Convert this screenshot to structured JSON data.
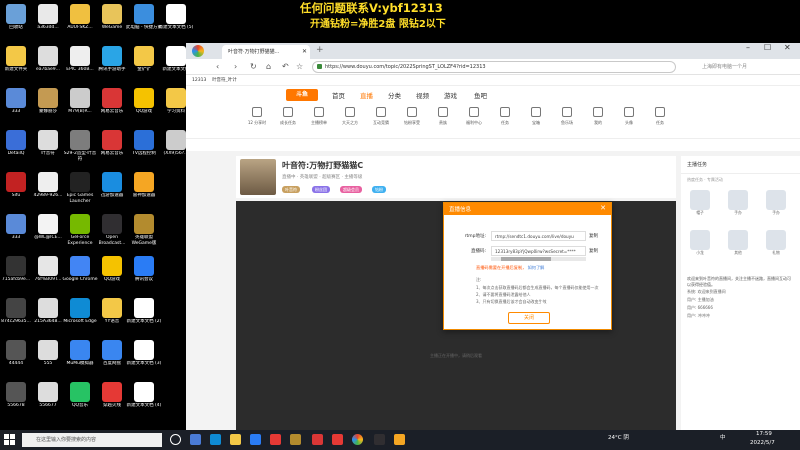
{
  "banner": {
    "line1": "任何问题联系V:ybf12313",
    "line2": "开通钻粉=净胜2盘 限钻2以下"
  },
  "desktop_icons": [
    {
      "label": "回收站",
      "color": "#6aa0d8"
    },
    {
      "label": "a363dd...",
      "color": "#e9e9e9"
    },
    {
      "label": "AUUFSKZ...",
      "color": "#f0c040"
    },
    {
      "label": "WeGame",
      "color": "#e8c45a"
    },
    {
      "label": "此电脑 - 快捷方式",
      "color": "#3b8ede"
    },
    {
      "label": "新建文本文档 (5)",
      "color": "#ffffff"
    },
    {
      "label": "新建文件夹",
      "color": "#f3c847"
    },
    {
      "label": "ea7bae9...",
      "color": "#dddddd"
    },
    {
      "label": "EPIC 360B...",
      "color": "#eeeeee"
    },
    {
      "label": "腾讯手游助手",
      "color": "#2aa5e6"
    },
    {
      "label": "金铲铲",
      "color": "#f3c847"
    },
    {
      "label": "新建文本文档",
      "color": "#ffffff"
    },
    {
      "label": "333",
      "color": "#5a8ad8"
    },
    {
      "label": "蒙娜丽莎",
      "color": "#c49a52"
    },
    {
      "label": "M79(B)R...",
      "color": "#cccccc"
    },
    {
      "label": "网易云音乐",
      "color": "#d93636"
    },
    {
      "label": "QQ游戏",
      "color": "#f5c200"
    },
    {
      "label": "学习资料",
      "color": "#f3c847"
    },
    {
      "label": "DetailQ",
      "color": "#3a6ed8"
    },
    {
      "label": "叶音符",
      "color": "#dddddd"
    },
    {
      "label": "S29-2造型·叶音符",
      "color": "#7d7d7d"
    },
    {
      "label": "网易云音乐",
      "color": "#d93636"
    },
    {
      "label": "TV远程控制",
      "color": "#2b6fd8"
    },
    {
      "label": "(XX9)56?...",
      "color": "#cccccc"
    },
    {
      "label": "Sifu",
      "color": "#c22222"
    },
    {
      "label": "42989-926...",
      "color": "#eeeeee"
    },
    {
      "label": "Epic Games Launcher",
      "color": "#222222"
    },
    {
      "label": "迅游加速器",
      "color": "#1a8de0"
    },
    {
      "label": "雷神加速器",
      "color": "#f5a623"
    },
    {
      "label": "",
      "color": "#000000"
    },
    {
      "label": "333",
      "color": "#5a8ad8"
    },
    {
      "label": "@WL@ICE...",
      "color": "#f3f3f3"
    },
    {
      "label": "GeForce Experience",
      "color": "#76b900"
    },
    {
      "label": "Open Broadcast...",
      "color": "#302e31"
    },
    {
      "label": "英雄联盟WeGame版",
      "color": "#b38b2e"
    },
    {
      "label": "",
      "color": "#000000"
    },
    {
      "label": "715afcb9e...",
      "color": "#333333"
    },
    {
      "label": "76f%B09T...",
      "color": "#e6e6e6"
    },
    {
      "label": "Google Chrome",
      "color": "#4285f4"
    },
    {
      "label": "QQ游戏",
      "color": "#f5c200"
    },
    {
      "label": "腾讯会议",
      "color": "#2a7cf5"
    },
    {
      "label": "",
      "color": "#000000"
    },
    {
      "label": "874c29635...",
      "color": "#444444"
    },
    {
      "label": "215A3648...",
      "color": "#dddddd"
    },
    {
      "label": "Microsoft Edge",
      "color": "#0f8bd4"
    },
    {
      "label": "YY语音",
      "color": "#f3c847"
    },
    {
      "label": "新建文本文档 (2)",
      "color": "#ffffff"
    },
    {
      "label": "",
      "color": "#000000"
    },
    {
      "label": "44444",
      "color": "#555555"
    },
    {
      "label": "555",
      "color": "#dddddd"
    },
    {
      "label": "MuMu模拟器",
      "color": "#3a86f0"
    },
    {
      "label": "百度网盘",
      "color": "#3a86f0"
    },
    {
      "label": "新建文本文档 (3)",
      "color": "#ffffff"
    },
    {
      "label": "",
      "color": "#000000"
    },
    {
      "label": "556678",
      "color": "#555555"
    },
    {
      "label": "556677",
      "color": "#dddddd"
    },
    {
      "label": "QQ音乐",
      "color": "#27c364"
    },
    {
      "label": "穿越火线",
      "color": "#e53935"
    },
    {
      "label": "新建文本文档 (4)",
      "color": "#ffffff"
    },
    {
      "label": "",
      "color": "#000000"
    }
  ],
  "browser": {
    "tab_title": "叶音符·万物打野猫猫...",
    "address": "https://www.douyu.com/topic/2022SpringST_LOLZF4?rid=12313",
    "search_placeholder": "上海即有电脑一个月",
    "bookmark": "12313",
    "bookmark2": "叶音符_叶计"
  },
  "douyu": {
    "logo": "斗鱼",
    "nav": [
      "首页",
      "直播",
      "分类",
      "视频",
      "游戏",
      "鱼吧"
    ],
    "categories": [
      "12 分享时",
      "成长任务",
      "主播榜单",
      "大天之方",
      "互动竞猜",
      "钻粉享受",
      "贵族",
      "福利中心",
      "任务",
      "宝箱",
      "鱼乐场",
      "我的",
      "头像",
      "任务"
    ],
    "room_title": "叶音符:万物打野猫猫C",
    "room_sub": "直播中 · 英雄联盟 · 超级赛区 · 主播等级",
    "room_tags": [
      "叶音符",
      "粉丝团",
      "超级会员",
      "钻粉"
    ],
    "player_hint": "主播正在开播中，请稍后观看",
    "side_title": "主播任务",
    "side_tabs": "热度任务 · 专属活动",
    "side_cells": [
      "帽子",
      "手办",
      "手办",
      "小龙",
      "其他",
      "礼物"
    ],
    "side_chat": "欢迎来到叶音符的直播间，关注主播不迷路，直播间互动可以获得经验值。",
    "chat_lines": [
      "系统: 欢迎来到直播间",
      "用户: 主播加油",
      "用户: 666666",
      "用户: 冲冲冲"
    ]
  },
  "dialog": {
    "title": "直播信息",
    "rtmp_label": "rtmp地址:",
    "rtmp_value": "rtmp://sendtc1.douyu.com/live/douyu",
    "code_label": "直播码:",
    "code_value": "12313ry83pYjQwp0irw?wsSecret=****",
    "copy": "复制",
    "warning": "直播码需要在开播后复制，",
    "warning_link": "如何了解",
    "notes": [
      "注:",
      "1、每次点击获取直播码后都会生成直播码，每个直播码仅能使用一次",
      "2、请不要将直播码泄露给他人",
      "3、只有切换直播后该才会自动改变生效"
    ],
    "button": "关闭"
  },
  "taskbar": {
    "search": "在这里输入你要搜索的内容",
    "weather": "24°C 阴",
    "lang": "中",
    "time": "17:59",
    "date": "2022/5/7"
  }
}
